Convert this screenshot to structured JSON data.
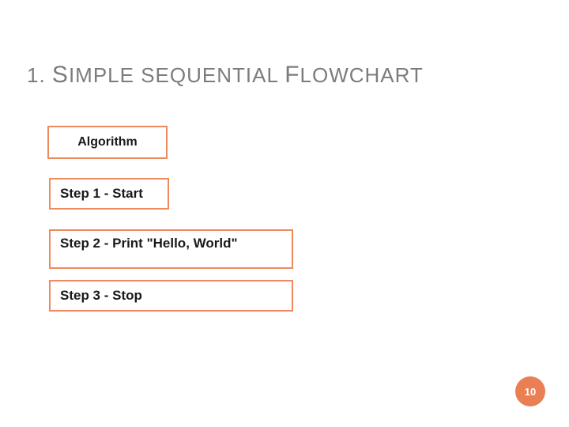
{
  "title": {
    "prefix": "1. ",
    "word1_first": "S",
    "word1_rest": "IMPLE",
    "word2": "SEQUENTIAL",
    "word3_first": "F",
    "word3_rest": "LOWCHART"
  },
  "algorithm": {
    "header": "Algorithm",
    "steps": [
      "Step 1 - Start",
      "Step 2 - Print \"Hello, World\"",
      "Step 3 - Stop"
    ]
  },
  "page_number": "10",
  "colors": {
    "box_border": "#ef8a5d",
    "title_text": "#7c7c7c",
    "badge": "#e97f52"
  }
}
